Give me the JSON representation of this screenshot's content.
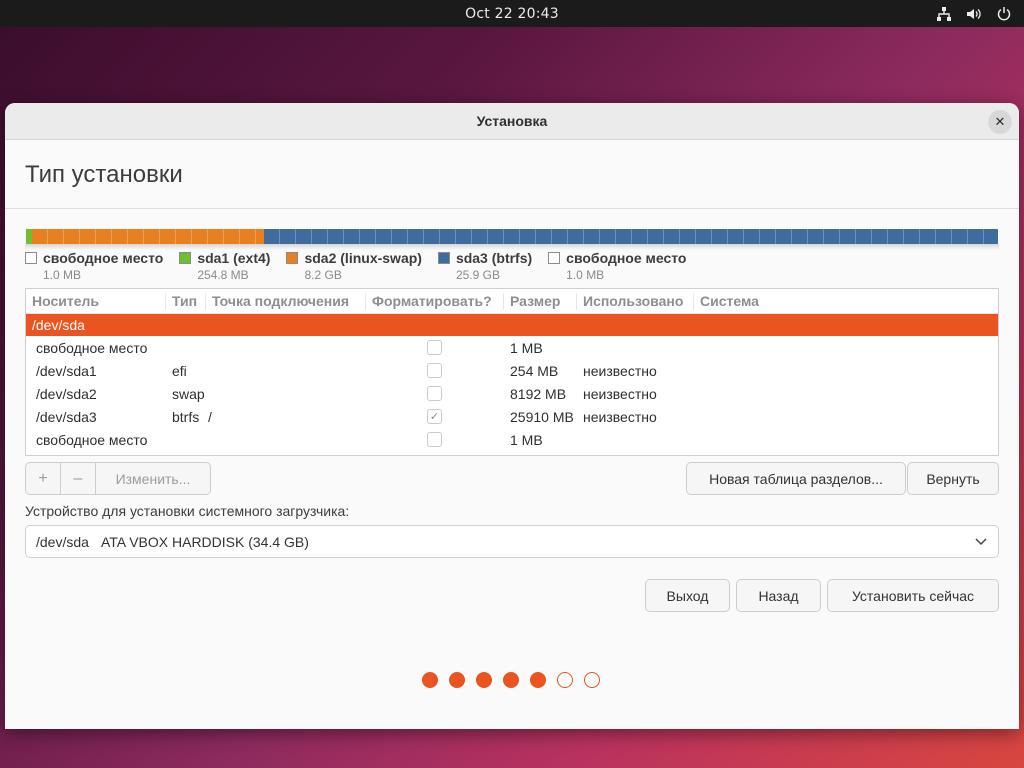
{
  "topbar": {
    "clock": "Oct 22  20:43"
  },
  "window": {
    "title": "Установка",
    "page_title": "Тип установки"
  },
  "colors": {
    "accent": "#e95420",
    "ext4": "#6fc030",
    "swap": "#e7801e",
    "btrfs": "#3f6b9f",
    "free": "#ffffff"
  },
  "disk_bar": [
    {
      "label": "свободное место",
      "size": "1.0 MB",
      "color": "#ffffff",
      "fraction": 3e-05
    },
    {
      "label": "sda1 (ext4)",
      "size": "254.8 MB",
      "color": "#6fc030",
      "fraction": 0.0074
    },
    {
      "label": "sda2 (linux-swap)",
      "size": "8.2 GB",
      "color": "#e7801e",
      "fraction": 0.238
    },
    {
      "label": "sda3 (btrfs)",
      "size": "25.9 GB",
      "color": "#3f6b9f",
      "fraction": 0.754
    },
    {
      "label": "свободное место",
      "size": "1.0 MB",
      "color": "#ffffff",
      "fraction": 3e-05
    }
  ],
  "table": {
    "columns": [
      "Носитель",
      "Тип",
      "Точка подключения",
      "Форматировать?",
      "Размер",
      "Использовано",
      "Система"
    ],
    "device": "/dev/sda",
    "rows": [
      {
        "device": "свободное место",
        "type": "",
        "mount": "",
        "format": false,
        "size": "1 MB",
        "used": "",
        "system": ""
      },
      {
        "device": "/dev/sda1",
        "type": "efi",
        "mount": "",
        "format": false,
        "size": "254 MB",
        "used": "неизвестно",
        "system": ""
      },
      {
        "device": "/dev/sda2",
        "type": "swap",
        "mount": "",
        "format": false,
        "size": "8192 MB",
        "used": "неизвестно",
        "system": ""
      },
      {
        "device": "/dev/sda3",
        "type": "btrfs",
        "mount": "/",
        "format": true,
        "size": "25910 MB",
        "used": "неизвестно",
        "system": ""
      },
      {
        "device": "свободное место",
        "type": "",
        "mount": "",
        "format": false,
        "size": "1 MB",
        "used": "",
        "system": ""
      }
    ]
  },
  "actions": {
    "add": "+",
    "remove": "–",
    "edit": "Изменить...",
    "new_table": "Новая таблица разделов...",
    "revert": "Вернуть"
  },
  "bootloader": {
    "label": "Устройство для установки системного загрузчика:",
    "device": "/dev/sda",
    "description": "ATA VBOX HARDDISK (34.4 GB)"
  },
  "nav": {
    "quit": "Выход",
    "back": "Назад",
    "install": "Установить сейчас"
  },
  "progress": {
    "total_steps": 7,
    "completed_steps": 5
  }
}
